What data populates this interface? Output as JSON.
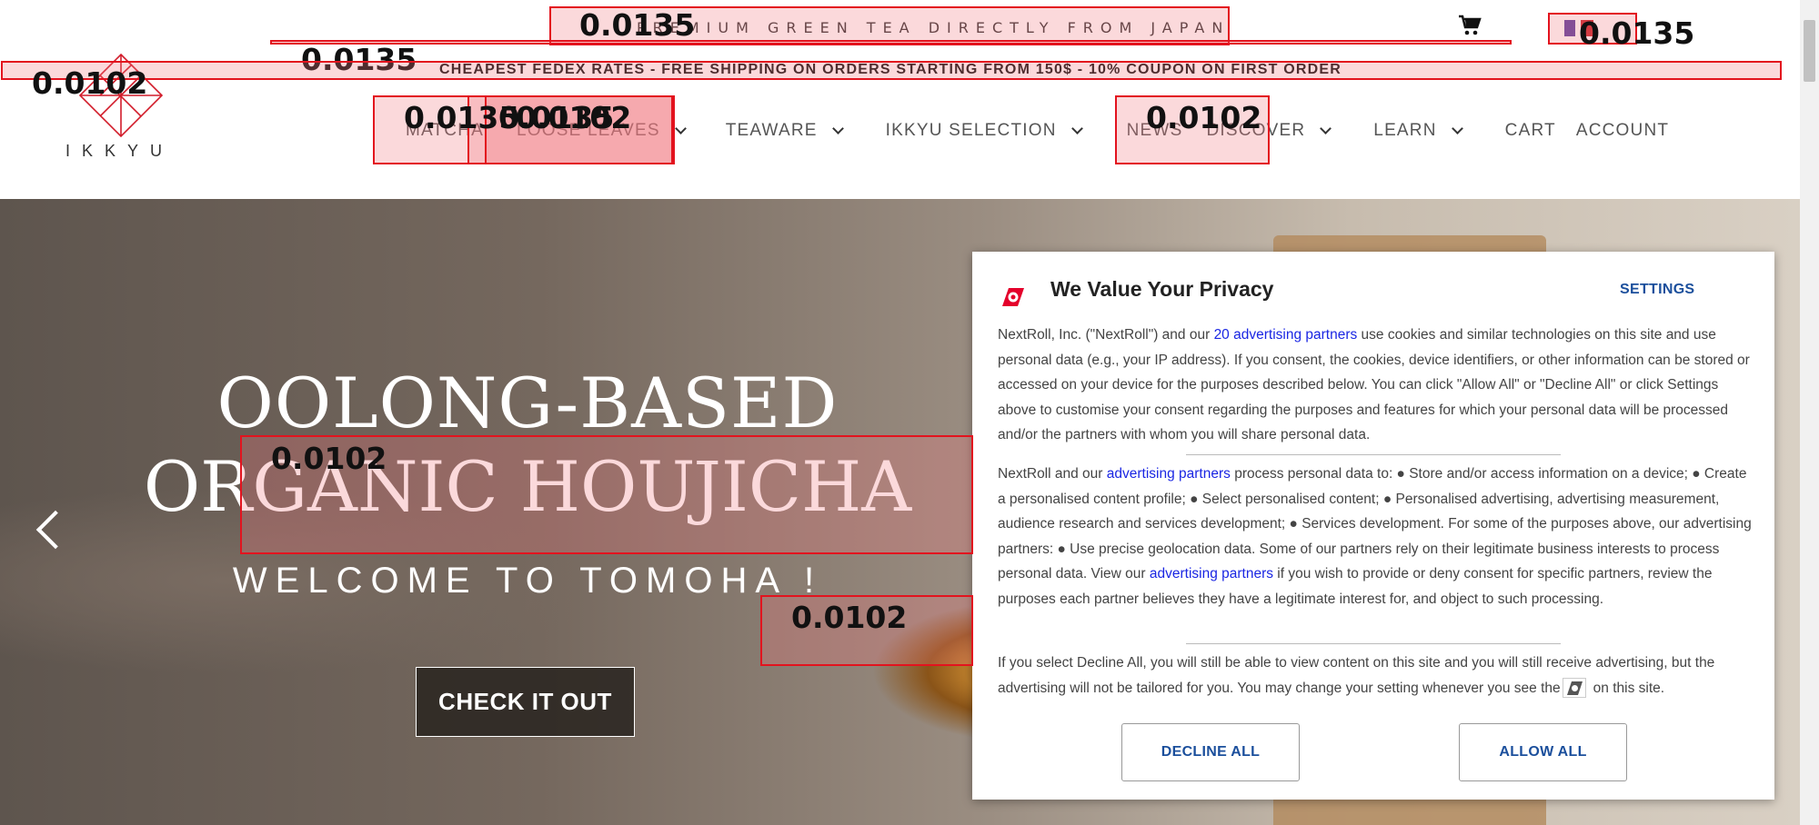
{
  "header": {
    "tagline": "PREMIUM GREEN TEA DIRECTLY FROM JAPAN",
    "shipping_banner": "CHEAPEST FEDEX RATES - FREE SHIPPING ON ORDERS STARTING FROM 150$ - 10% COUPON ON FIRST ORDER",
    "logo_text": "IKKYU",
    "cart_icon": "cart-icon",
    "flag_icon": "france-flag-icon"
  },
  "nav": {
    "items": [
      {
        "label": "MATCHA",
        "dropdown": false
      },
      {
        "label": "LOOSE LEAVES",
        "dropdown": true
      },
      {
        "label": "TEAWARE",
        "dropdown": true
      },
      {
        "label": "IKKYU SELECTION",
        "dropdown": true
      },
      {
        "label": "NEWS",
        "dropdown": false
      },
      {
        "label": "DISCOVER",
        "dropdown": true
      },
      {
        "label": "LEARN",
        "dropdown": true
      },
      {
        "label": "CART",
        "dropdown": false
      },
      {
        "label": "ACCOUNT",
        "dropdown": false
      }
    ]
  },
  "hero": {
    "line1": "OOLONG-BASED",
    "line2": "ORGANIC HOUJICHA",
    "subtitle": "WELCOME TO TOMOHA !",
    "cta": "CHECK IT OUT",
    "prev_icon": "chevron-left-icon"
  },
  "consent": {
    "title": "We Value Your Privacy",
    "settings": "SETTINGS",
    "p1_before": "NextRoll, Inc. (\"NextRoll\") and our ",
    "p1_link": "20 advertising partners",
    "p1_after": " use cookies and similar technologies on this site and use personal data (e.g., your IP address). If you consent, the cookies, device identifiers, or other information can be stored or accessed on your device for the purposes described below. You can click \"Allow All\" or \"Decline All\" or click Settings above to customise your consent regarding the purposes and features for which your personal data will be processed and/or the partners with whom you will share personal data.",
    "p2_before": "NextRoll and our ",
    "p2_link1": "advertising partners",
    "p2_mid": " process personal data to: ● Store and/or access information on a device; ● Create a personalised content profile; ● Select personalised content; ● Personalised advertising, advertising measurement, audience research and services development; ● Services development. For some of the purposes above, our advertising partners: ● Use precise geolocation data. Some of our partners rely on their legitimate business interests to process personal data. View our ",
    "p2_link2": "advertising partners",
    "p2_after": " if you wish to provide or deny consent for specific partners, review the purposes each partner believes they have a legitimate interest for, and object to such processing.",
    "p3_before": "If you select Decline All, you will still be able to view content on this site and you will still receive advertising, but the advertising will not be tailored for you. You may change your setting whenever you see the",
    "p3_after": "on this site.",
    "decline": "DECLINE ALL",
    "allow": "ALLOW ALL",
    "brand_color": "#e4002b",
    "button_color": "#1b4f9c"
  },
  "overlay_labels": {
    "tagline_box": "0.0135",
    "flag_box": "0.0135",
    "banner_line": "0.0135",
    "logo_box": "0.0102",
    "matcha_box": "0.0135",
    "loose_box_a": "0.0135",
    "loose_box_b": "0.0102",
    "discover_box": "0.0102",
    "hero_box": "0.0102",
    "cta_box": "0.0102"
  }
}
